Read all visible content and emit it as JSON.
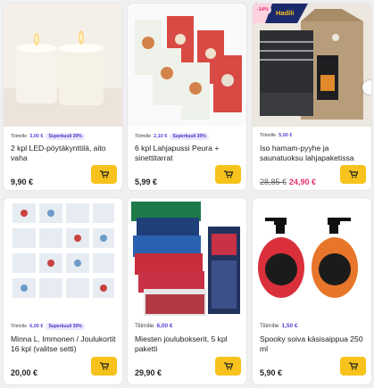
{
  "colors": {
    "accent": "#f7c21b",
    "points": "#5b3fd6",
    "sale": "#e2316d"
  },
  "icons": {
    "cart": "shopping-cart-icon"
  },
  "products": [
    {
      "points_label": "Tilimille",
      "points": "3,00 €",
      "badge": "Superkuuli 30%",
      "title": "2 kpl LED-pöytäkynttilä, aito vaha",
      "price": "9,90 €"
    },
    {
      "points_label": "Tilimille",
      "points": "2,10 €",
      "badge": "Superkuuli 30%",
      "title": "6 kpl Lahjapussi Peura + sinettitarrat",
      "price": "5,99 €"
    },
    {
      "points_label": "Tilimille",
      "points": "5,00 €",
      "sale_flag": "-14%",
      "ribbon": "Hadili",
      "title": "Iso hamam-pyyhe ja saunatuoksu lahjapaketissa",
      "old_price": "28,85 €",
      "price": "24,90 €"
    },
    {
      "points_label": "Tilimille",
      "points": "6,00 €",
      "badge": "Superkuuli 30%",
      "title": "Minna L. Immonen / Joulukortit 16 kpl (valitse setti)",
      "price": "20,00 €"
    },
    {
      "points_label": "Tilimille",
      "points": "6,00 €",
      "title": "Miesten joulubokserit, 5 kpl paketti",
      "price": "29,90 €"
    },
    {
      "points_label": "Tilimille",
      "points": "1,50 €",
      "title": "Spooky soiva käsisaippua 250 ml",
      "price": "5,90 €"
    }
  ]
}
